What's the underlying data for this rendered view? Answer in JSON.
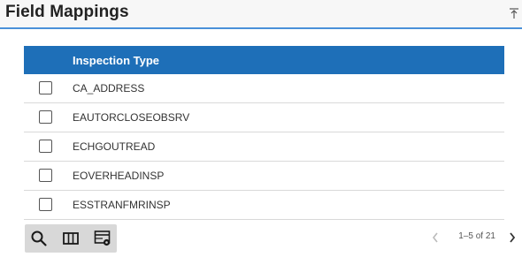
{
  "header": {
    "title": "Field Mappings"
  },
  "table": {
    "column_header": "Inspection Type",
    "rows": [
      {
        "value": "CA_ADDRESS"
      },
      {
        "value": "EAUTORCLOSEOBSRV"
      },
      {
        "value": "ECHGOUTREAD"
      },
      {
        "value": "EOVERHEADINSP"
      },
      {
        "value": "ESSTRANFMRINSP"
      }
    ]
  },
  "toolbar": {
    "icons": [
      "search-icon",
      "columns-icon",
      "table-settings-icon"
    ]
  },
  "pagination": {
    "info": "1–5 of 21"
  },
  "colors": {
    "header_bg": "#1e6fb8",
    "accent_line": "#4a90d9",
    "toolbar_bg": "#d8d8d8"
  }
}
